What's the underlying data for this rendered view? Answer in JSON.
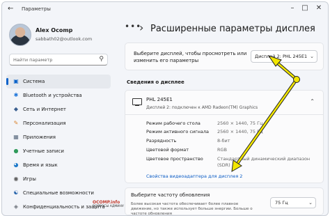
{
  "window": {
    "title": "Параметры"
  },
  "user": {
    "name": "Alex Ocomp",
    "email": "sabbath02@outlook.com"
  },
  "search": {
    "placeholder": "Найти параметр"
  },
  "nav": {
    "items": [
      {
        "label": "Система",
        "icon": "monitor-icon",
        "active": true
      },
      {
        "label": "Bluetooth и устройства",
        "icon": "bluetooth-icon"
      },
      {
        "label": "Сеть и Интернет",
        "icon": "wifi-icon"
      },
      {
        "label": "Персонализация",
        "icon": "brush-icon"
      },
      {
        "label": "Приложения",
        "icon": "apps-icon"
      },
      {
        "label": "Учетные записи",
        "icon": "person-icon"
      },
      {
        "label": "Время и язык",
        "icon": "globe-icon"
      },
      {
        "label": "Игры",
        "icon": "gamepad-icon"
      },
      {
        "label": "Специальные возможности",
        "icon": "accessibility-icon"
      },
      {
        "label": "Конфиденциальность и защита",
        "icon": "shield-icon"
      }
    ]
  },
  "page": {
    "title": "Расширенные параметры дисплея"
  },
  "display_select": {
    "prompt": "Выберите дисплей, чтобы просмотреть или изменить его параметры",
    "value": "Дисплей 2: PHL 245E1"
  },
  "display_info": {
    "heading": "Сведения о дисплее",
    "monitor_name": "PHL 245E1",
    "monitor_desc": "Дисплей 2: подключен к AMD Radeon(TM) Graphics",
    "rows": [
      {
        "label": "Режим рабочего стола",
        "value": "2560 × 1440, 75 Гц"
      },
      {
        "label": "Режим активного сигнала",
        "value": "2560 × 1440, 75 Гц"
      },
      {
        "label": "Разрядность",
        "value": "8-бит"
      },
      {
        "label": "Цветовой формат",
        "value": "RGB"
      },
      {
        "label": "Цветовое пространство",
        "value": "Стандартный динамический диапазон (SDR)"
      }
    ],
    "adapter_link": "Свойства видеоадаптера для дисплея 2"
  },
  "refresh": {
    "title": "Выберите частоту обновления",
    "desc": "Более высокая частота обеспечивает более плавное движение, но также использует больше энергии. Больше о частоте обновления",
    "value": "75 Гц"
  },
  "watermark": {
    "brand": "OCOMP.info",
    "tagline": "ВОПРОСЫ АДМИНУ"
  },
  "colors": {
    "accent": "#0a62c9",
    "annotation_arrow": "#f2e600"
  }
}
